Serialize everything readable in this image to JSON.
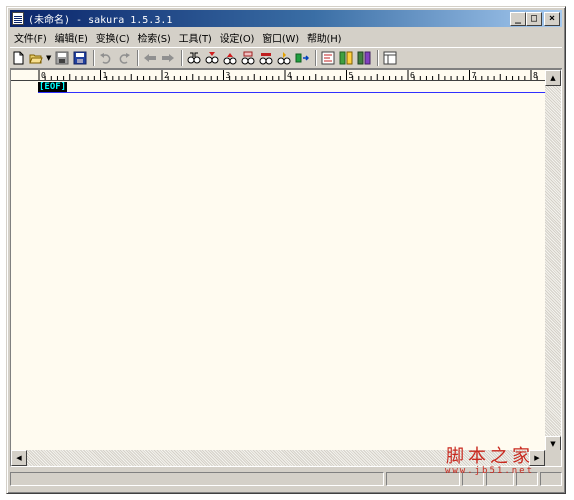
{
  "window": {
    "title": "(未命名) - sakura 1.5.3.1",
    "buttons": {
      "minimize": "_",
      "maximize": "□",
      "close": "×"
    }
  },
  "menu": [
    {
      "label": "文件(F)"
    },
    {
      "label": "编辑(E)"
    },
    {
      "label": "变换(C)"
    },
    {
      "label": "检索(S)"
    },
    {
      "label": "工具(T)"
    },
    {
      "label": "设定(O)"
    },
    {
      "label": "窗口(W)"
    },
    {
      "label": "帮助(H)"
    }
  ],
  "toolbar": {
    "icons": [
      "new-file-icon",
      "open-file-icon",
      "save-icon",
      "save-all-icon",
      "undo-icon",
      "redo-icon",
      "jump-back-icon",
      "jump-forward-icon",
      "find-icon",
      "find-next-icon",
      "find-prev-icon",
      "replace-icon",
      "grep-icon",
      "tag-jump-icon",
      "compare-icon",
      "outline-icon",
      "function-list-icon",
      "settings-icon"
    ]
  },
  "ruler": {
    "labels": [
      "0",
      "1",
      "2",
      "3",
      "4",
      "5",
      "6",
      "7",
      "8"
    ]
  },
  "editor": {
    "eof_marker": "[EOF]",
    "background": "#fffbf0"
  },
  "watermark": {
    "text": "脚本之家",
    "url": "www.jb51.net"
  }
}
